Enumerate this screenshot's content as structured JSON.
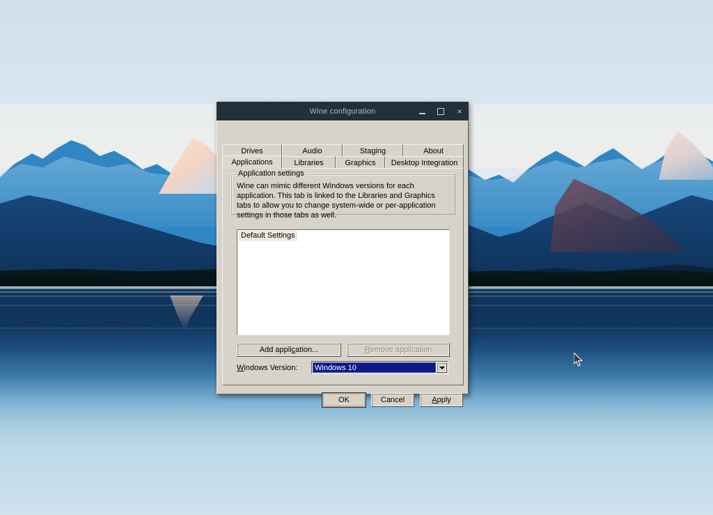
{
  "desktop": {
    "wallpaper_description": "mountain-lake-wallpaper",
    "cursor": "arrow-cursor"
  },
  "window": {
    "title": "Wine configuration",
    "title_color": "#a9bdc9",
    "titlebar_color": "#22303a",
    "face_color": "#d7d3c8",
    "controls": {
      "minimize": "minimize-icon",
      "maximize": "maximize-icon",
      "close": "×"
    }
  },
  "tabs": {
    "row1": [
      {
        "label": "Drives",
        "selected": false
      },
      {
        "label": "Audio",
        "selected": false
      },
      {
        "label": "Staging",
        "selected": false
      },
      {
        "label": "About",
        "selected": false
      }
    ],
    "row2": [
      {
        "label": "Applications",
        "selected": true
      },
      {
        "label": "Libraries",
        "selected": false
      },
      {
        "label": "Graphics",
        "selected": false
      },
      {
        "label": "Desktop Integration",
        "selected": false
      }
    ]
  },
  "application_settings": {
    "group_label": "Application settings",
    "description": "Wine can mimic different Windows versions for each application. This tab is linked to the Libraries and Graphics tabs to allow you to change system-wide or per-application settings in those tabs as well.",
    "list": [
      {
        "label": "Default Settings",
        "selected": true
      }
    ],
    "add_button": {
      "prefix": "",
      "mnemonic": "A",
      "suffix": "dd application..."
    },
    "add_button_label": "Add application...",
    "remove_button": {
      "mnemonic": "R",
      "suffix": "emove application"
    },
    "remove_button_label": "Remove application",
    "remove_button_enabled": false,
    "windows_version_label": "Windows Version:",
    "windows_version_label_mnemonic": "W",
    "windows_version_label_rest": "indows Version:",
    "windows_version_value": "Windows 10",
    "combo_highlight_color": "#0b1a86"
  },
  "dialog_buttons": {
    "ok": "OK",
    "cancel": "Cancel",
    "apply_mnemonic": "A",
    "apply_rest": "pply",
    "apply_label": "Apply"
  }
}
